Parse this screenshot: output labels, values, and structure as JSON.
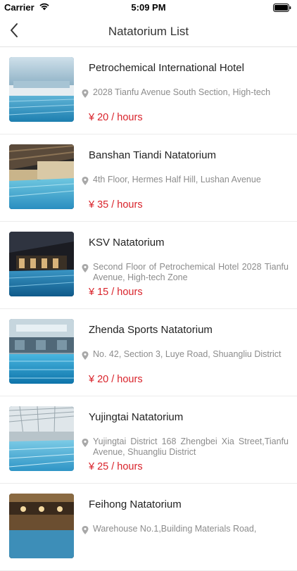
{
  "status": {
    "carrier": "Carrier",
    "time": "5:09 PM"
  },
  "nav": {
    "title": "Natatorium List",
    "back_icon": "chevron-left-icon"
  },
  "items": [
    {
      "name": "Petrochemical International Hotel",
      "address": "2028 Tianfu Avenue South Section, High-tech",
      "price": "¥ 20 / hours"
    },
    {
      "name": "Banshan Tiandi Natatorium",
      "address": "4th Floor, Hermes Half Hill, Lushan Avenue",
      "price": "¥ 35 / hours"
    },
    {
      "name": "KSV Natatorium",
      "address": "Second Floor of Petrochemical Hotel 2028 Tianfu Avenue, High-tech Zone",
      "price": "¥ 15 / hours"
    },
    {
      "name": "Zhenda Sports Natatorium",
      "address": "No. 42, Section 3, Luye Road, Shuangliu District",
      "price": "¥ 20 / hours"
    },
    {
      "name": "Yujingtai Natatorium",
      "address": "Yujingtai District 168 Zhengbei Xia Street,Tianfu Avenue, Shuangliu District",
      "price": "¥ 25 / hours"
    },
    {
      "name": "Feihong Natatorium",
      "address": "Warehouse No.1,Building Materials Road,",
      "price": ""
    }
  ],
  "colors": {
    "price": "#d9232b",
    "address": "#8c8c8c"
  }
}
